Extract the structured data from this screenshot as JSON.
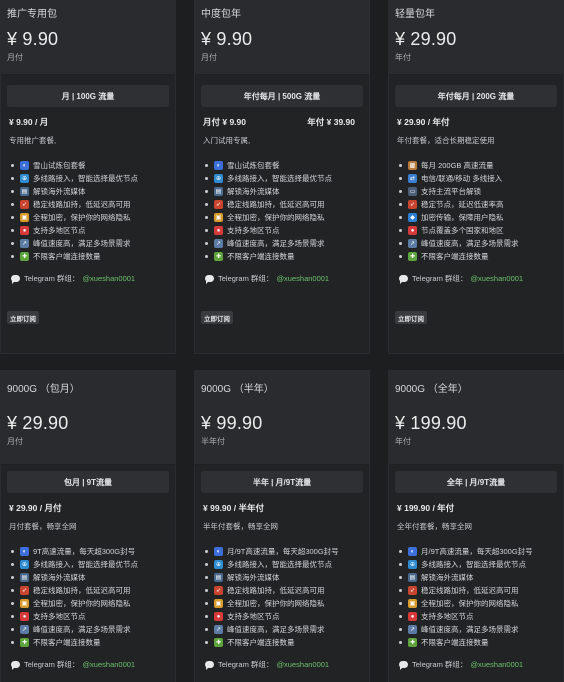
{
  "cards": [
    {
      "head": "推广专用包",
      "price": "¥ 9.90",
      "period": "月付",
      "tab": "月 | 100G 流量",
      "line_left": "¥ 9.90 / 月",
      "line_right": "",
      "desc": "专用推广套餐,",
      "features": [
        {
          "icon": "globe-icon",
          "text": "雪山试炼包套餐"
        },
        {
          "icon": "network-icon",
          "text": "多线路接入，智能选择最优节点"
        },
        {
          "icon": "film-icon",
          "text": "解锁海外流媒体"
        },
        {
          "icon": "rocket-icon",
          "text": "稳定线路加持，低延迟高可用"
        },
        {
          "icon": "lock-icon",
          "text": "全程加密，保护你的网络隐私"
        },
        {
          "icon": "pin-icon",
          "text": "支持多地区节点"
        },
        {
          "icon": "chart-icon",
          "text": "峰值速度高，满足多场景需求"
        },
        {
          "icon": "puzzle-icon",
          "text": "不限客户端连接数量"
        }
      ],
      "tg_label": "Telegram 群组：",
      "tg_handle": "@xueshan0001",
      "order": "立即订阅"
    },
    {
      "head": "中度包年",
      "price": "¥ 9.90",
      "period": "月付",
      "tab": "年付每月 | 500G 流量",
      "line_left": "月付 ¥ 9.90",
      "line_right": "年付 ¥ 39.90",
      "desc": "入门试用专属,",
      "features": [
        {
          "icon": "globe-icon",
          "text": "雪山试炼包套餐"
        },
        {
          "icon": "network-icon",
          "text": "多线路接入，智能选择最优节点"
        },
        {
          "icon": "film-icon",
          "text": "解锁海外流媒体"
        },
        {
          "icon": "rocket-icon",
          "text": "稳定线路加持，低延迟高可用"
        },
        {
          "icon": "lock-icon",
          "text": "全程加密，保护你的网络隐私"
        },
        {
          "icon": "pin-icon",
          "text": "支持多地区节点"
        },
        {
          "icon": "chart-icon",
          "text": "峰值速度高，满足多场景需求"
        },
        {
          "icon": "puzzle-icon",
          "text": "不限客户端连接数量"
        }
      ],
      "tg_label": "Telegram 群组：",
      "tg_handle": "@xueshan0001",
      "order": "立即订阅"
    },
    {
      "head": "轻量包年",
      "price": "¥ 29.90",
      "period": "年付",
      "tab": "年付每月 | 200G 流量",
      "line_left": "¥ 29.90 / 年付",
      "line_right": "",
      "desc": "年付套餐，适合长期稳定使用",
      "features": [
        {
          "icon": "box-icon",
          "text": "每月 200GB 高速流量"
        },
        {
          "icon": "arrows-icon",
          "text": "电信/联通/移动 多线接入"
        },
        {
          "icon": "tv-icon",
          "text": "支持主流平台解锁"
        },
        {
          "icon": "rocket-icon",
          "text": "稳定节点，延迟低速率高"
        },
        {
          "icon": "shield-icon",
          "text": "加密传输，保障用户隐私"
        },
        {
          "icon": "pin-icon",
          "text": "节点覆盖多个国家和地区"
        },
        {
          "icon": "chart-icon",
          "text": "峰值速度高，满足多场景需求"
        },
        {
          "icon": "puzzle-icon",
          "text": "不限客户端连接数量"
        }
      ],
      "tg_label": "Telegram 群组：",
      "tg_handle": "@xueshan0001",
      "order": "立即订阅"
    },
    {
      "head": "9000G （包月）",
      "price": "¥ 29.90",
      "period": "月付",
      "tab": "包月 | 9T流量",
      "line_left": "¥ 29.90 / 月付",
      "line_right": "",
      "desc": "月付套餐，畅享全网",
      "features": [
        {
          "icon": "globe-icon",
          "text": "9T高速流量，每天超300G封号"
        },
        {
          "icon": "network-icon",
          "text": "多线路接入，智能选择最优节点"
        },
        {
          "icon": "film-icon",
          "text": "解锁海外流媒体"
        },
        {
          "icon": "rocket-icon",
          "text": "稳定线路加持，低延迟高可用"
        },
        {
          "icon": "lock-icon",
          "text": "全程加密，保护你的网络隐私"
        },
        {
          "icon": "pin-icon",
          "text": "支持多地区节点"
        },
        {
          "icon": "chart-icon",
          "text": "峰值速度高，满足多场景需求"
        },
        {
          "icon": "puzzle-icon",
          "text": "不限客户端连接数量"
        }
      ],
      "tg_label": "Telegram 群组：",
      "tg_handle": "@xueshan0001",
      "order": ""
    },
    {
      "head": "9000G （半年）",
      "price": "¥ 99.90",
      "period": "半年付",
      "tab": "半年 | 月/9T流量",
      "line_left": "¥ 99.90 / 半年付",
      "line_right": "",
      "desc": "半年付套餐，畅享全网",
      "features": [
        {
          "icon": "globe-icon",
          "text": "月/9T高速流量，每天超300G封号"
        },
        {
          "icon": "network-icon",
          "text": "多线路接入，智能选择最优节点"
        },
        {
          "icon": "film-icon",
          "text": "解锁海外流媒体"
        },
        {
          "icon": "rocket-icon",
          "text": "稳定线路加持，低延迟高可用"
        },
        {
          "icon": "lock-icon",
          "text": "全程加密，保护你的网络隐私"
        },
        {
          "icon": "pin-icon",
          "text": "支持多地区节点"
        },
        {
          "icon": "chart-icon",
          "text": "峰值速度高，满足多场景需求"
        },
        {
          "icon": "puzzle-icon",
          "text": "不限客户端连接数量"
        }
      ],
      "tg_label": "Telegram 群组：",
      "tg_handle": "@xueshan0001",
      "order": ""
    },
    {
      "head": "9000G （全年）",
      "price": "¥ 199.90",
      "period": "年付",
      "tab": "全年 | 月/9T流量",
      "line_left": "¥ 199.90 / 年付",
      "line_right": "",
      "desc": "全年付套餐，畅享全网",
      "features": [
        {
          "icon": "globe-icon",
          "text": "月/9T高速流量，每天超300G封号"
        },
        {
          "icon": "network-icon",
          "text": "多线路接入，智能选择最优节点"
        },
        {
          "icon": "film-icon",
          "text": "解锁海外流媒体"
        },
        {
          "icon": "rocket-icon",
          "text": "稳定线路加持，低延迟高可用"
        },
        {
          "icon": "lock-icon",
          "text": "全程加密，保护你的网络隐私"
        },
        {
          "icon": "pin-icon",
          "text": "支持多地区节点"
        },
        {
          "icon": "chart-icon",
          "text": "峰值速度高，满足多场景需求"
        },
        {
          "icon": "puzzle-icon",
          "text": "不限客户端连接数量"
        }
      ],
      "tg_label": "Telegram 群组：",
      "tg_handle": "@xueshan0001",
      "order": ""
    }
  ]
}
